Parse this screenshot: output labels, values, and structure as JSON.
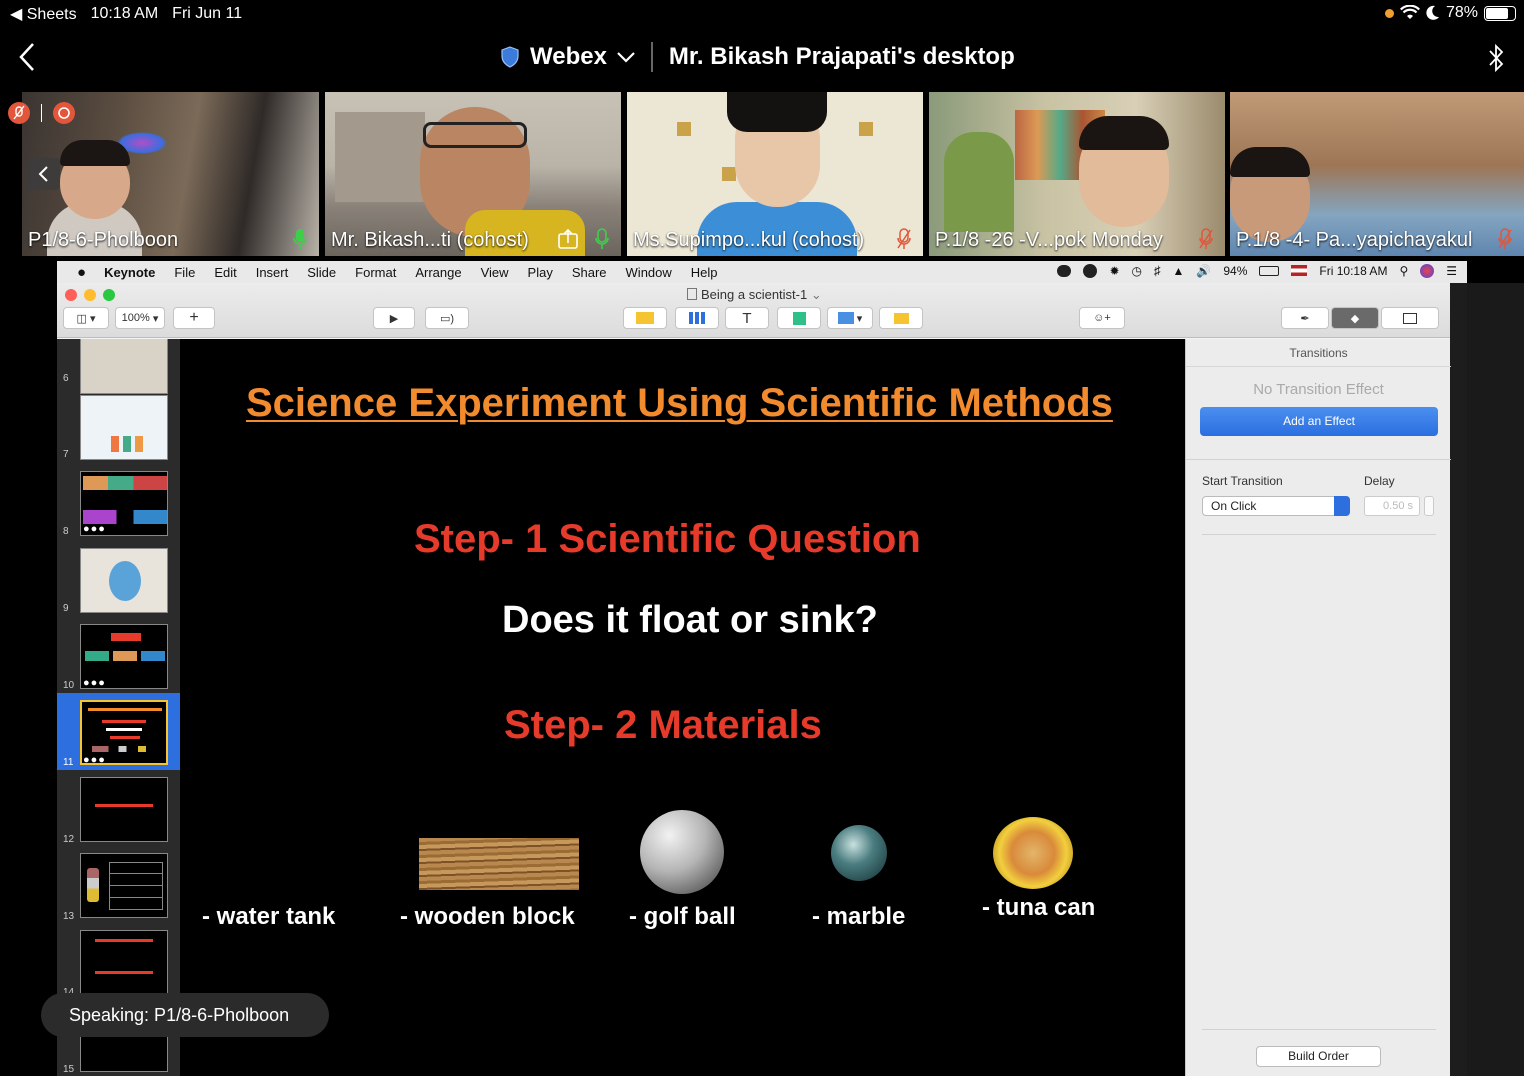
{
  "status_bar": {
    "back_app": "◀ Sheets",
    "time": "10:18 AM",
    "date": "Fri Jun 11",
    "battery": "78%",
    "battery_level": 0.78
  },
  "webex": {
    "app_name": "Webex",
    "meeting_title": "Mr. Bikash Prajapati's desktop"
  },
  "participants": [
    {
      "name": "P1/8-6-Pholboon",
      "mic": "on"
    },
    {
      "name": "Mr. Bikash...ti (cohost)",
      "mic": "on",
      "sharing": true
    },
    {
      "name": "Ms.Supimpo...kul (cohost)",
      "mic": "muted"
    },
    {
      "name": "P.1/8 -26 -V...pok Monday",
      "mic": "muted"
    },
    {
      "name": "P.1/8 -4- Pa...yapichayakul",
      "mic": "muted"
    }
  ],
  "mac_menubar": {
    "items": [
      "Keynote",
      "File",
      "Edit",
      "Insert",
      "Slide",
      "Format",
      "Arrange",
      "View",
      "Play",
      "Share",
      "Window",
      "Help"
    ],
    "battery": "94%",
    "clock": "Fri 10:18 AM"
  },
  "keynote": {
    "document_title": "Being a scientist-1",
    "zoom": "100%",
    "slide_numbers": [
      "6",
      "7",
      "8",
      "9",
      "10",
      "11",
      "12",
      "13",
      "14",
      "15"
    ],
    "selected_slide": "11",
    "slide": {
      "title": "Science Experiment Using Scientific Methods",
      "step1": "Step- 1 Scientific Question",
      "question": "Does it float or sink?",
      "step2": "Step- 2 Materials",
      "materials": [
        "- water tank",
        "- wooden block",
        "- golf ball",
        "- marble",
        "- tuna can"
      ]
    },
    "inspector": {
      "header": "Transitions",
      "no_effect": "No Transition Effect",
      "add_effect": "Add an Effect",
      "start_label": "Start Transition",
      "start_value": "On Click",
      "delay_label": "Delay",
      "delay_value": "0.50 s",
      "build_order": "Build Order"
    }
  },
  "speaking": "Speaking: P1/8-6-Pholboon",
  "colors": {
    "title_orange": "#f28a2e",
    "step_red": "#e63a2a",
    "accent_blue": "#2e6fe0"
  }
}
